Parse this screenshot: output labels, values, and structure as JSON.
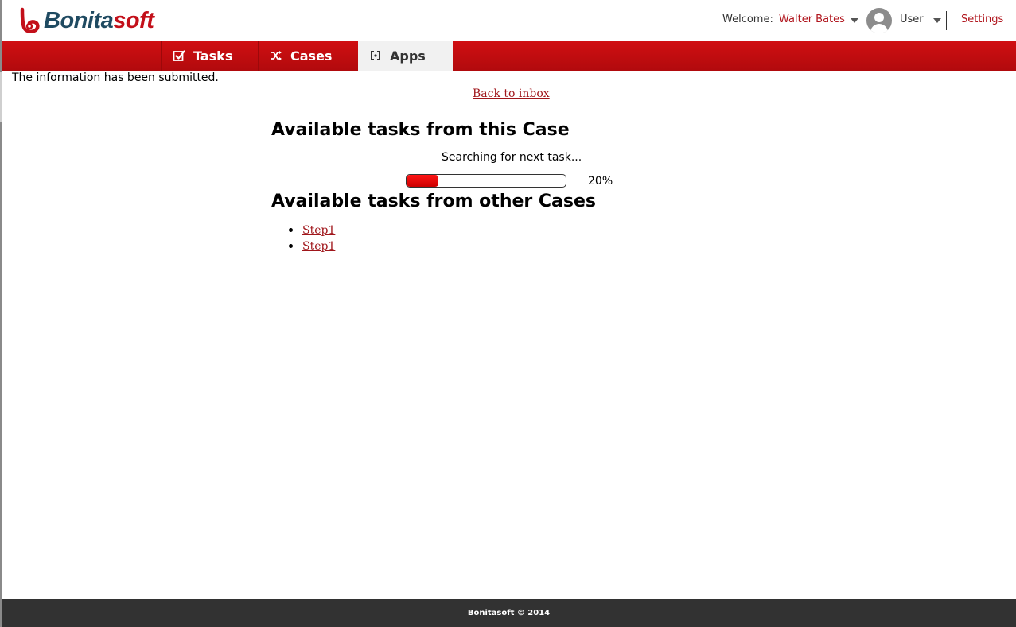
{
  "header": {
    "logo": {
      "part1": "Bonita",
      "part2": "soft"
    },
    "welcome_label": "Welcome:",
    "user_name": "Walter Bates",
    "profile_label": "User",
    "settings_label": "Settings"
  },
  "nav": {
    "items": [
      {
        "label": "Tasks",
        "icon": "checkbox-icon"
      },
      {
        "label": "Cases",
        "icon": "shuffle-icon"
      },
      {
        "label": "Apps",
        "icon": "apps-icon",
        "active": true
      }
    ]
  },
  "main": {
    "submitted_message": "The information has been submitted.",
    "back_link": "Back to inbox",
    "this_case_heading": "Available tasks from this Case",
    "searching_text": "Searching for next task...",
    "progress": {
      "value": 20,
      "label": "20%"
    },
    "other_cases_heading": "Available tasks from other Cases",
    "other_tasks": [
      {
        "label": "Step1"
      },
      {
        "label": "Step1"
      }
    ]
  },
  "footer": {
    "text": "Bonitasoft © 2014"
  },
  "colors": {
    "brand_red": "#c3101a",
    "brand_blue": "#1f4a61",
    "link_red": "#a0161b",
    "footer_bg": "#323232"
  }
}
